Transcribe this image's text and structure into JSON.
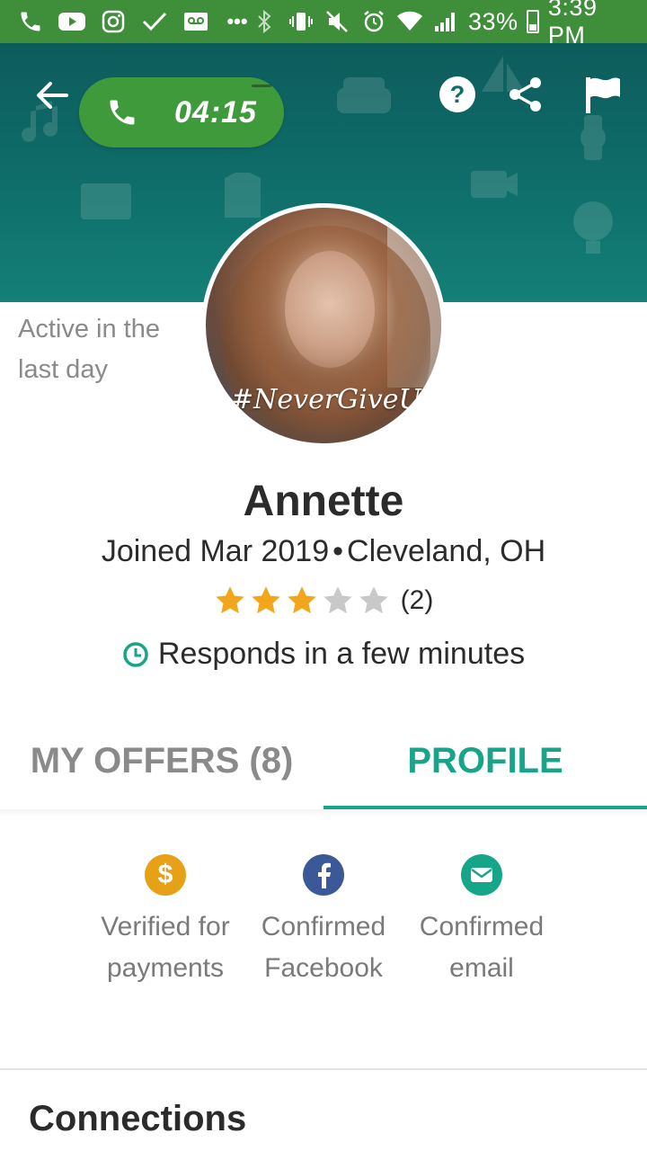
{
  "status_bar": {
    "battery": "33%",
    "time": "3:39 PM",
    "icons": [
      "phone-icon",
      "youtube-icon",
      "instagram-icon",
      "check-icon",
      "voicemail-icon",
      "more-icon",
      "bluetooth-icon",
      "vibrate-icon",
      "mute-icon",
      "alarm-icon",
      "wifi-icon",
      "signal-icon",
      "battery-icon"
    ]
  },
  "call": {
    "timer": "04:15"
  },
  "header": {
    "icons": [
      "back-arrow-icon",
      "help-icon",
      "share-icon",
      "flag-icon"
    ]
  },
  "profile": {
    "activity": "Active in the last day",
    "name": "Annette",
    "joined": "Joined Mar 2019",
    "separator": "•",
    "location": "Cleveland, OH",
    "rating": 3,
    "rating_max": 5,
    "rating_count": "(2)",
    "responds": "Responds in a few minutes",
    "photo_caption": "#NeverGiveUp"
  },
  "tabs": {
    "offers": "MY OFFERS (8)",
    "profile": "PROFILE",
    "active": "profile"
  },
  "verifications": {
    "payments": {
      "label": "Verified for payments",
      "icon": "dollar-icon",
      "color": "#e6a117"
    },
    "facebook": {
      "label": "Confirmed Facebook",
      "icon": "facebook-icon",
      "color": "#3b5998"
    },
    "email": {
      "label": "Confirmed email",
      "icon": "email-icon",
      "color": "#17a589"
    }
  },
  "sections": {
    "connections": "Connections"
  },
  "colors": {
    "status_bar": "#3e8e3a",
    "banner": "#0f6e6a",
    "accent": "#17a589",
    "star_filled": "#f2a71b",
    "star_empty": "#c8c8c8"
  }
}
